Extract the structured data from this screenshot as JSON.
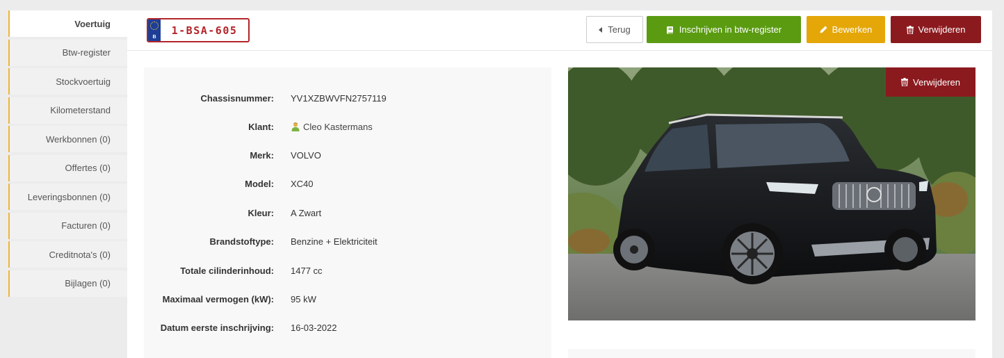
{
  "sidebar": {
    "items": [
      {
        "label": "Voertuig",
        "active": true
      },
      {
        "label": "Btw-register"
      },
      {
        "label": "Stockvoertuig"
      },
      {
        "label": "Kilometerstand"
      },
      {
        "label": "Werkbonnen (0)"
      },
      {
        "label": "Offertes (0)"
      },
      {
        "label": "Leveringsbonnen (0)"
      },
      {
        "label": "Facturen (0)"
      },
      {
        "label": "Creditnota's (0)"
      },
      {
        "label": "Bijlagen (0)"
      }
    ]
  },
  "plate": {
    "country": "B",
    "number": "1-BSA-605"
  },
  "toolbar": {
    "back_label": "Terug",
    "btw_label": "Inschrijven in btw-register",
    "edit_label": "Bewerken",
    "delete_label": "Verwijderen"
  },
  "details": {
    "rows": [
      {
        "label": "Chassisnummer:",
        "value": "YV1XZBWVFN2757119"
      },
      {
        "label": "Klant:",
        "value": "Cleo Kastermans"
      },
      {
        "label": "Merk:",
        "value": "VOLVO"
      },
      {
        "label": "Model:",
        "value": "XC40"
      },
      {
        "label": "Kleur:",
        "value": "A Zwart"
      },
      {
        "label": "Brandstoftype:",
        "value": "Benzine + Elektriciteit"
      },
      {
        "label": "Totale cilinderinhoud:",
        "value": "1477 cc"
      },
      {
        "label": "Maximaal vermogen (kW):",
        "value": "95 kW"
      },
      {
        "label": "Datum eerste inschrijving:",
        "value": "16-03-2022"
      }
    ]
  },
  "photo": {
    "delete_label": "Verwijderen"
  },
  "colors": {
    "accent": "#f0b432",
    "green": "#5a9b11",
    "yellow": "#e5a708",
    "red": "#8b1a1f",
    "plate_red": "#b3242a",
    "eu_blue": "#1d3e97"
  }
}
